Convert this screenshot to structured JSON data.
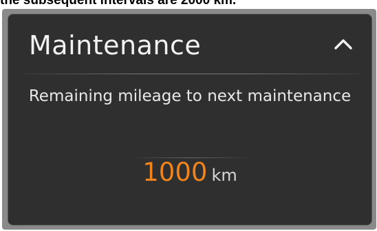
{
  "caption": "the subsequent intervals are 2000 km.",
  "panel": {
    "title": "Maintenance",
    "subtitle": "Remaining mileage to next maintenance",
    "value": "1000",
    "unit": "km",
    "collapse_icon": "chevron-up-icon"
  },
  "colors": {
    "panel_bg": "#2f2f2f",
    "accent": "#f0841c",
    "text": "#f2f2f2"
  }
}
